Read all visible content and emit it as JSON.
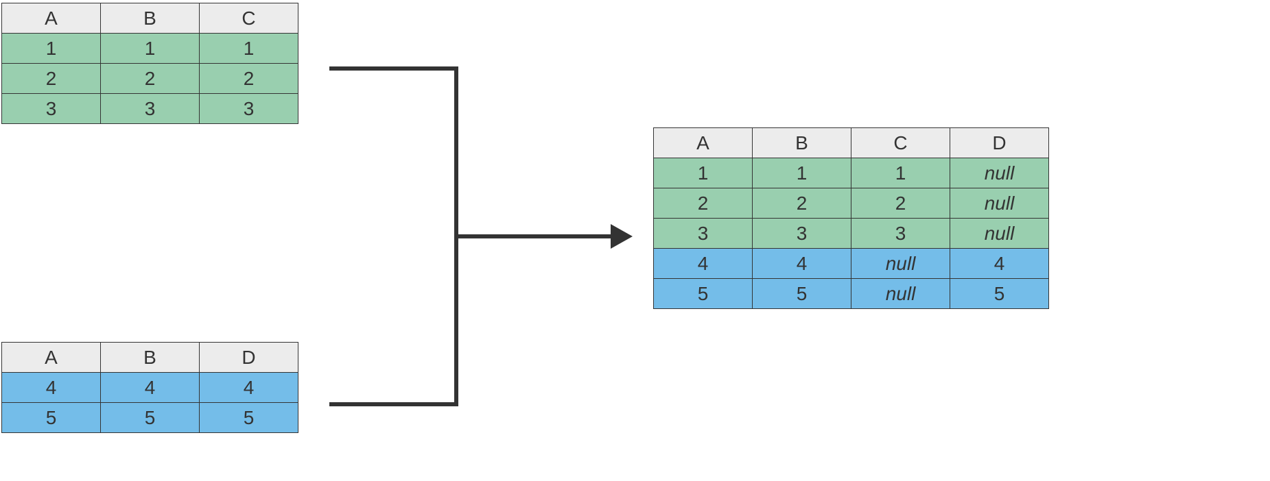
{
  "colors": {
    "header_bg": "#ececec",
    "green": "#99cfaf",
    "blue": "#74bde9",
    "border": "#333333",
    "arrow": "#333333"
  },
  "table1": {
    "headers": [
      "A",
      "B",
      "C"
    ],
    "rows": [
      {
        "cells": [
          "1",
          "1",
          "1"
        ],
        "color": "green"
      },
      {
        "cells": [
          "2",
          "2",
          "2"
        ],
        "color": "green"
      },
      {
        "cells": [
          "3",
          "3",
          "3"
        ],
        "color": "green"
      }
    ]
  },
  "table2": {
    "headers": [
      "A",
      "B",
      "D"
    ],
    "rows": [
      {
        "cells": [
          "4",
          "4",
          "4"
        ],
        "color": "blue"
      },
      {
        "cells": [
          "5",
          "5",
          "5"
        ],
        "color": "blue"
      }
    ]
  },
  "table3": {
    "headers": [
      "A",
      "B",
      "C",
      "D"
    ],
    "rows": [
      {
        "cells": [
          "1",
          "1",
          "1",
          "null"
        ],
        "color": "green",
        "null_cols": [
          3
        ]
      },
      {
        "cells": [
          "2",
          "2",
          "2",
          "null"
        ],
        "color": "green",
        "null_cols": [
          3
        ]
      },
      {
        "cells": [
          "3",
          "3",
          "3",
          "null"
        ],
        "color": "green",
        "null_cols": [
          3
        ]
      },
      {
        "cells": [
          "4",
          "4",
          "null",
          "4"
        ],
        "color": "blue",
        "null_cols": [
          2
        ]
      },
      {
        "cells": [
          "5",
          "5",
          "null",
          "5"
        ],
        "color": "blue",
        "null_cols": [
          2
        ]
      }
    ]
  }
}
